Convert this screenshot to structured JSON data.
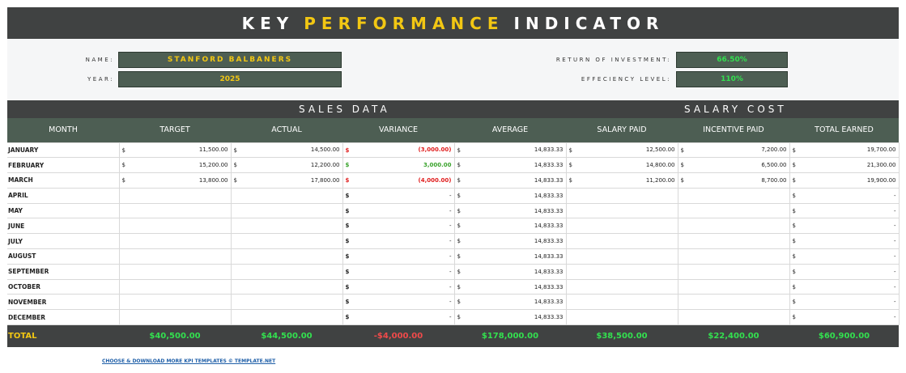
{
  "title": {
    "part1": "KEY",
    "part2": "PERFORMANCE",
    "part3": "INDICATOR"
  },
  "info": {
    "name_label": "NAME:",
    "name_value": "STANFORD BALBANERS",
    "year_label": "YEAR:",
    "year_value": "2025",
    "roi_label": "RETURN OF INVESTMENT:",
    "roi_value": "66.50%",
    "eff_label": "EFFECIENCY LEVEL:",
    "eff_value": "110%"
  },
  "sections": {
    "sales": "SALES DATA",
    "salary": "SALARY COST"
  },
  "columns": [
    "MONTH",
    "TARGET",
    "ACTUAL",
    "VARIANCE",
    "AVERAGE",
    "SALARY PAID",
    "INCENTIVE PAID",
    "TOTAL EARNED"
  ],
  "currency": "$",
  "rows": [
    {
      "month": "JANUARY",
      "target": "11,500.00",
      "actual": "14,500.00",
      "variance": "(3,000.00)",
      "vtype": "neg",
      "average": "14,833.33",
      "salary": "12,500.00",
      "incentive": "7,200.00",
      "total": "19,700.00"
    },
    {
      "month": "FEBRUARY",
      "target": "15,200.00",
      "actual": "12,200.00",
      "variance": "3,000.00",
      "vtype": "pos",
      "average": "14,833.33",
      "salary": "14,800.00",
      "incentive": "6,500.00",
      "total": "21,300.00"
    },
    {
      "month": "MARCH",
      "target": "13,800.00",
      "actual": "17,800.00",
      "variance": "(4,000.00)",
      "vtype": "neg",
      "average": "14,833.33",
      "salary": "11,200.00",
      "incentive": "8,700.00",
      "total": "19,900.00"
    },
    {
      "month": "APRIL",
      "target": "",
      "actual": "",
      "variance": "-",
      "vtype": "zero",
      "average": "14,833.33",
      "salary": "",
      "incentive": "",
      "total": "-"
    },
    {
      "month": "MAY",
      "target": "",
      "actual": "",
      "variance": "-",
      "vtype": "zero",
      "average": "14,833.33",
      "salary": "",
      "incentive": "",
      "total": "-"
    },
    {
      "month": "JUNE",
      "target": "",
      "actual": "",
      "variance": "-",
      "vtype": "zero",
      "average": "14,833.33",
      "salary": "",
      "incentive": "",
      "total": "-"
    },
    {
      "month": "JULY",
      "target": "",
      "actual": "",
      "variance": "-",
      "vtype": "zero",
      "average": "14,833.33",
      "salary": "",
      "incentive": "",
      "total": "-"
    },
    {
      "month": "AUGUST",
      "target": "",
      "actual": "",
      "variance": "-",
      "vtype": "zero",
      "average": "14,833.33",
      "salary": "",
      "incentive": "",
      "total": "-"
    },
    {
      "month": "SEPTEMBER",
      "target": "",
      "actual": "",
      "variance": "-",
      "vtype": "zero",
      "average": "14,833.33",
      "salary": "",
      "incentive": "",
      "total": "-"
    },
    {
      "month": "OCTOBER",
      "target": "",
      "actual": "",
      "variance": "-",
      "vtype": "zero",
      "average": "14,833.33",
      "salary": "",
      "incentive": "",
      "total": "-"
    },
    {
      "month": "NOVEMBER",
      "target": "",
      "actual": "",
      "variance": "-",
      "vtype": "zero",
      "average": "14,833.33",
      "salary": "",
      "incentive": "",
      "total": "-"
    },
    {
      "month": "DECEMBER",
      "target": "",
      "actual": "",
      "variance": "-",
      "vtype": "zero",
      "average": "14,833.33",
      "salary": "",
      "incentive": "",
      "total": "-"
    }
  ],
  "totals": {
    "label": "TOTAL",
    "target": "$40,500.00",
    "actual": "$44,500.00",
    "variance": "-$4,000.00",
    "average": "$178,000.00",
    "salary": "$38,500.00",
    "incentive": "$22,400.00",
    "total": "$60,900.00"
  },
  "footer_link": "CHOOSE & DOWNLOAD MORE KPI TEMPLATES © TEMPLATE.NET",
  "colors": {
    "header_dark": "#404242",
    "header_green": "#4d5e53",
    "accent_yellow": "#f2c713",
    "positive_green": "#3aa32c",
    "negative_red": "#e01d1d"
  }
}
